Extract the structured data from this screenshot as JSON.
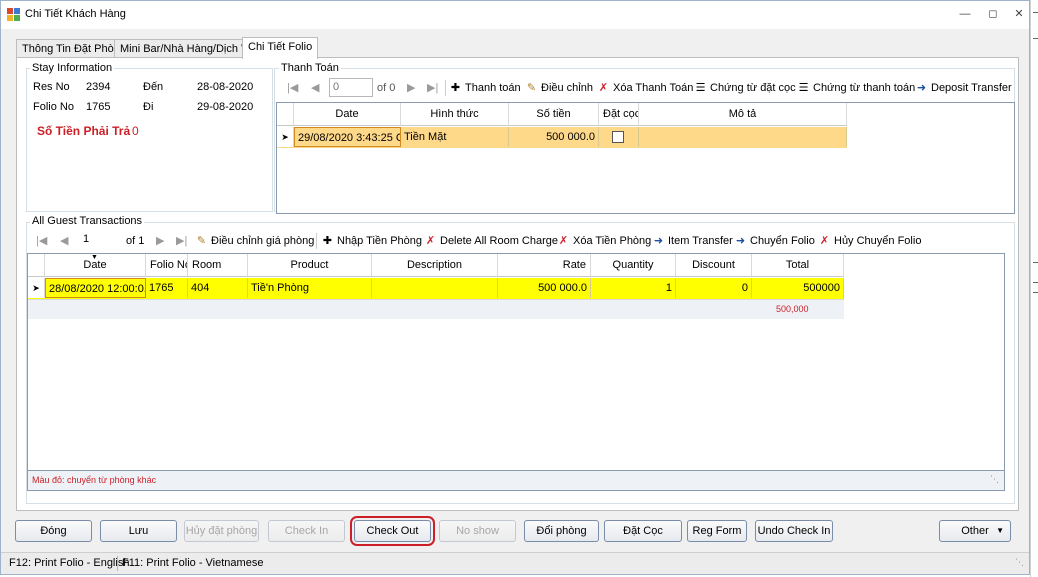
{
  "window": {
    "title": "Chi Tiết Khách Hàng"
  },
  "tabs": [
    "Thông Tin Đặt Phòng",
    "Mini Bar/Nhà Hàng/Dịch Vụ",
    "Chi Tiết Folio"
  ],
  "stay_info": {
    "title": "Stay Information",
    "res_no_label": "Res No",
    "res_no": "2394",
    "folio_no_label": "Folio No",
    "folio_no": "1765",
    "arrive_label": "Đến",
    "arrive_date": "28-08-2020",
    "depart_label": "Đi",
    "depart_date": "29-08-2020",
    "amount_due_label": "Số Tiền Phải Trả",
    "amount_due": "0"
  },
  "payment": {
    "title": "Thanh Toán",
    "pager": {
      "current": "0",
      "of": "of 0"
    },
    "toolbar": [
      "Thanh toán",
      "Điều chỉnh",
      "Xóa Thanh Toán",
      "Chứng từ đặt cọc",
      "Chứng từ thanh toán",
      "Deposit Transfer"
    ],
    "columns": [
      "Date",
      "Hình thức",
      "Số tiền",
      "Đặt cọc",
      "Mô tả"
    ],
    "rows": [
      {
        "date": "29/08/2020 3:43:25 CH",
        "method": "Tiền Mặt",
        "amount": "500 000.0",
        "deposit": false,
        "description": ""
      }
    ]
  },
  "transactions": {
    "title": "All Guest Transactions",
    "pager": {
      "current": "1",
      "of": "of 1"
    },
    "toolbar": [
      "Điều chỉnh giá phòng",
      "Nhập Tiền Phòng",
      "Delete All Room Charge",
      "Xóa Tiền Phòng",
      "Item Transfer",
      "Chuyển Folio",
      "Hủy Chuyển Folio"
    ],
    "columns": [
      "Date",
      "Folio No",
      "Room",
      "Product",
      "Description",
      "Rate",
      "Quantity",
      "Discount",
      "Total"
    ],
    "rows": [
      {
        "date": "28/08/2020  12:00:0...",
        "folio_no": "1765",
        "room": "404",
        "product": "Tiề'n Phòng",
        "description": "",
        "rate": "500 000.0",
        "quantity": "1",
        "discount": "0",
        "total": "500000"
      }
    ],
    "summary_total": "500,000",
    "note": "Màu đỏ: chuyển từ phòng khác"
  },
  "buttons": [
    {
      "label": "Đóng",
      "enabled": true
    },
    {
      "label": "Lưu",
      "enabled": true
    },
    {
      "label": "Hủy đặt phòng",
      "enabled": false
    },
    {
      "label": "Check In",
      "enabled": false
    },
    {
      "label": "Check Out",
      "enabled": true,
      "highlighted": true
    },
    {
      "label": "No show",
      "enabled": false
    },
    {
      "label": "Đổi phòng",
      "enabled": true
    },
    {
      "label": "Đặt Cọc",
      "enabled": true
    },
    {
      "label": "Reg Form",
      "enabled": true
    },
    {
      "label": "Undo Check In",
      "enabled": true
    },
    {
      "label": "Other",
      "enabled": true
    }
  ],
  "status_bar": [
    "F12: Print Folio - English",
    "F11: Print Folio - Vietnamese"
  ],
  "colors": {
    "selected_row": "#ffff00",
    "payment_row": "#ffd98a",
    "alert_red": "#cc1f27",
    "highlight_border": "#cc1f27"
  }
}
